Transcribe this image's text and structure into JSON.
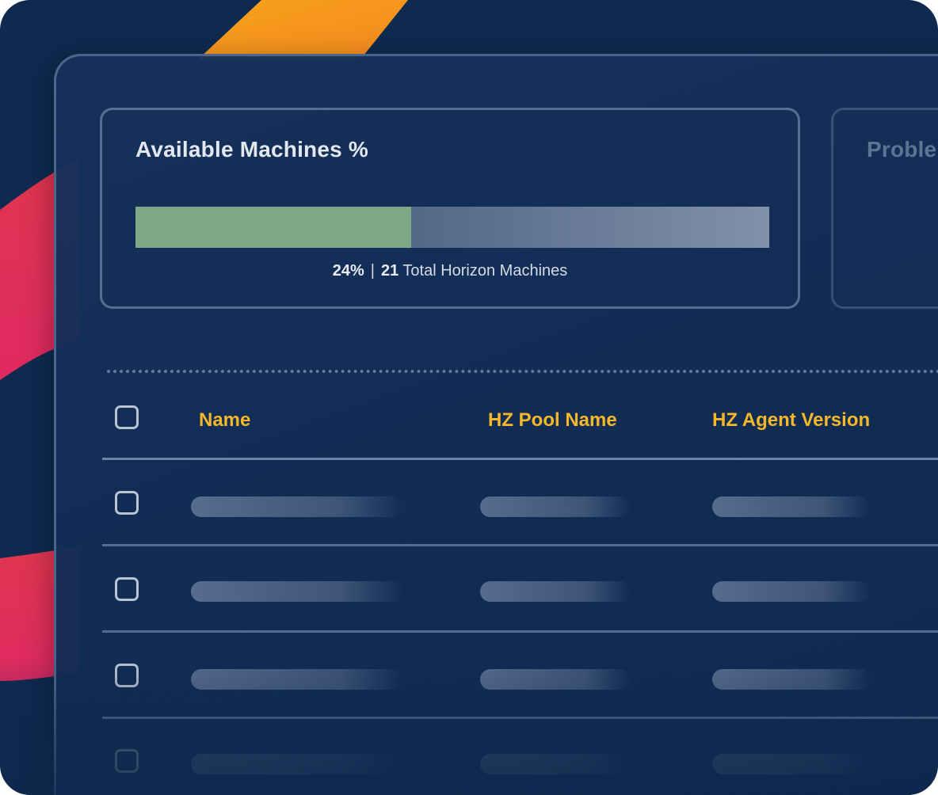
{
  "cards": {
    "available": {
      "title": "Available Machines %",
      "percent_label": "24%",
      "percent_value": 24,
      "separator": "|",
      "total_count": "21",
      "total_label": "Total Horizon Machines"
    },
    "problems": {
      "title": "Proble"
    }
  },
  "table": {
    "columns": [
      "Name",
      "HZ Pool Name",
      "HZ Agent Version"
    ],
    "row_count": 4
  },
  "colors": {
    "background": "#0e2a4f",
    "accent_header": "#f4b829",
    "bar_fill": "#7ea886"
  }
}
